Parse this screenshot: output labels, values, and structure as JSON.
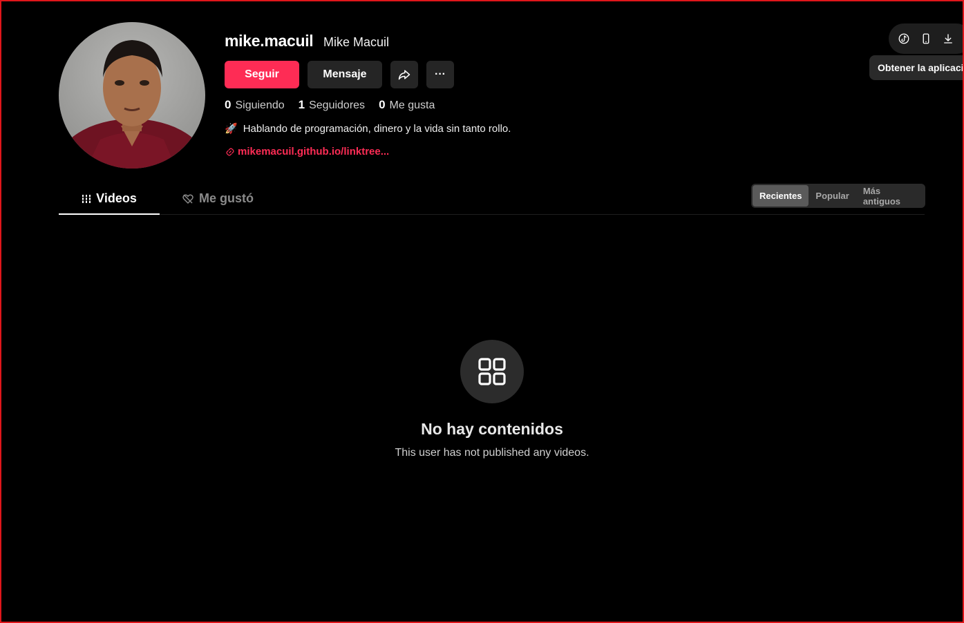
{
  "profile": {
    "username": "mike.macuil",
    "display_name": "Mike Macuil",
    "bio_emoji": "🚀",
    "bio": "Hablando de programación, dinero y la vida sin tanto rollo.",
    "link": "mikemacuil.github.io/linktree..."
  },
  "actions": {
    "follow": "Seguir",
    "message": "Mensaje",
    "more": "···"
  },
  "stats": [
    {
      "value": "0",
      "label": "Siguiendo"
    },
    {
      "value": "1",
      "label": "Seguidores"
    },
    {
      "value": "0",
      "label": "Me gusta"
    }
  ],
  "app_bar": {
    "tooltip": "Obtener la aplicación",
    "icons": [
      "tiktok-icon",
      "mobile-icon",
      "download-icon"
    ]
  },
  "tabs": {
    "videos": "Videos",
    "liked": "Me gustó"
  },
  "sort": {
    "recent": "Recientes",
    "popular": "Popular",
    "oldest": "Más antiguos"
  },
  "empty": {
    "title": "No hay contenidos",
    "subtitle": "This user has not published any videos."
  },
  "colors": {
    "accent": "#fe2c55",
    "background": "#000000",
    "frame_border": "#e0161b"
  }
}
